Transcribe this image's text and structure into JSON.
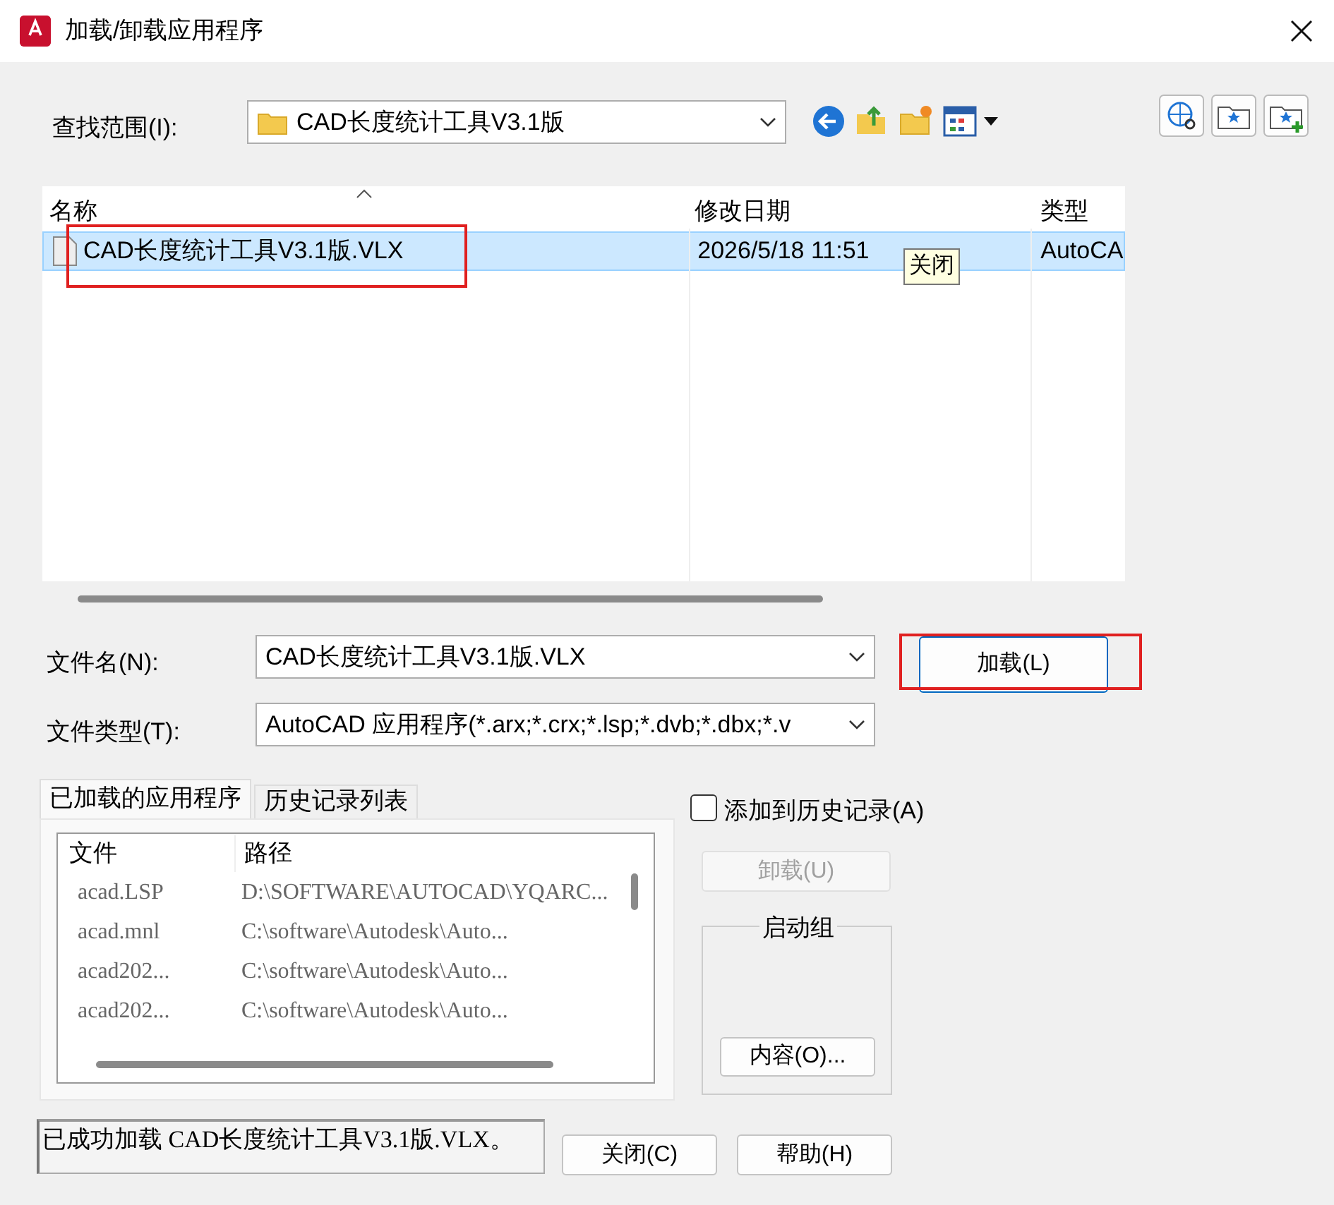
{
  "window": {
    "title": "加载/卸载应用程序"
  },
  "look_in": {
    "label": "查找范围(I):",
    "value": "CAD长度统计工具V3.1版"
  },
  "file_list": {
    "columns": [
      "名称",
      "修改日期",
      "类型"
    ],
    "rows": [
      {
        "name": "CAD长度统计工具V3.1版.VLX",
        "modified": "2026/5/18 11:51",
        "type": "AutoCA",
        "selected": true,
        "highlighted": true
      }
    ],
    "tooltip": "关闭"
  },
  "file_name": {
    "label": "文件名(N):",
    "value": "CAD长度统计工具V3.1版.VLX"
  },
  "file_type": {
    "label": "文件类型(T):",
    "value": "AutoCAD 应用程序(*.arx;*.crx;*.lsp;*.dvb;*.dbx;*.v"
  },
  "load_button": {
    "label": "加载(L)",
    "disabled": false,
    "highlighted": true
  },
  "tabs": [
    {
      "label": "已加载的应用程序",
      "selected": true
    },
    {
      "label": "历史记录列表",
      "selected": false
    }
  ],
  "loaded": {
    "columns": [
      "文件",
      "路径"
    ],
    "rows": [
      {
        "file": "acad.LSP",
        "path": "D:\\SOFTWARE\\AUTOCAD\\YQARC..."
      },
      {
        "file": "acad.mnl",
        "path": "C:\\software\\Autodesk\\Auto..."
      },
      {
        "file": "acad202...",
        "path": "C:\\software\\Autodesk\\Auto..."
      },
      {
        "file": "acad202...",
        "path": "C:\\software\\Autodesk\\Auto..."
      }
    ]
  },
  "add_history": {
    "label": "添加到历史记录(A)",
    "checked": false
  },
  "unload_button": {
    "label": "卸载(U)",
    "disabled": true
  },
  "startup_group": {
    "title": "启动组",
    "button": "内容(O)..."
  },
  "status": "已成功加载 CAD长度统计工具V3.1版.VLX。",
  "bottom_buttons": [
    "关闭(C)",
    "帮助(H)"
  ]
}
